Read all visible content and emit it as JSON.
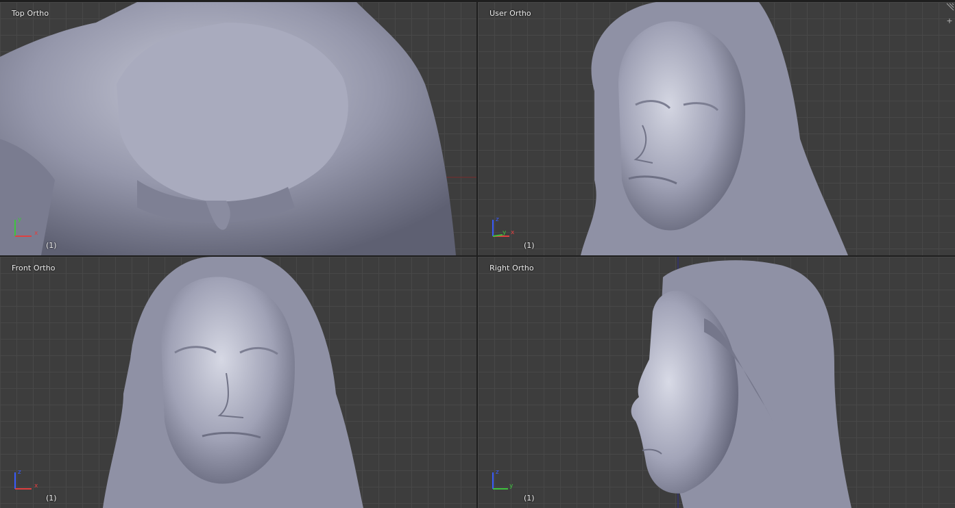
{
  "viewports": {
    "top": {
      "label": "Top Ortho",
      "frame": "(1)",
      "axis_v": "y",
      "axis_h": "x"
    },
    "user": {
      "label": "User Ortho",
      "frame": "(1)",
      "axis_v": "z",
      "axis_h": "x",
      "axis_mid": "y"
    },
    "front": {
      "label": "Front Ortho",
      "frame": "(1)",
      "axis_v": "z",
      "axis_h": "x"
    },
    "right": {
      "label": "Right Ortho",
      "frame": "(1)",
      "axis_v": "z",
      "axis_h": "y"
    }
  },
  "colors": {
    "grid_bg": "#3d3d3d",
    "mesh": "#9a9cb0",
    "axis_x": "#e04040",
    "axis_y": "#3ec43e",
    "axis_z": "#3a5cff"
  },
  "icons": {
    "split_corner": "viewport-split-icon",
    "add_corner": "plus-icon"
  }
}
